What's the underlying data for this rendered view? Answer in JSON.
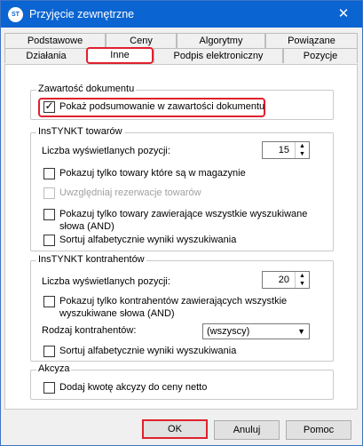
{
  "window": {
    "icon_text": "ST",
    "title": "Przyjęcie zewnętrzne",
    "close_glyph": "✕"
  },
  "tabs": {
    "row1": [
      "Podstawowe",
      "Ceny",
      "Algorytmy",
      "Powiązane"
    ],
    "row2": [
      "Działania",
      "Inne",
      "Podpis elektroniczny",
      "Pozycje"
    ],
    "active": "Inne"
  },
  "zawartosc": {
    "title": "Zawartość dokumentu",
    "summary_checkbox": {
      "label": "Pokaż podsumowanie w zawartości dokumentu",
      "checked": true
    }
  },
  "towary": {
    "title": "InsTYNKT towarów",
    "count_label": "Liczba wyświetlanych pozycji:",
    "count_value": "15",
    "only_in_stock": {
      "label": "Pokazuj tylko towary które są w magazynie",
      "checked": false
    },
    "reservations": {
      "label": "Uwzględniaj rezerwacje towarów",
      "checked": false,
      "disabled": true
    },
    "all_words_line1": "Pokazuj tylko towary zawierające wszystkie wyszukiwane",
    "all_words_line2": "słowa (AND)",
    "sort_alpha": {
      "label": "Sortuj alfabetycznie wyniki wyszukiwania",
      "checked": false
    }
  },
  "kontrahenci": {
    "title": "InsTYNKT kontrahentów",
    "count_label": "Liczba wyświetlanych pozycji:",
    "count_value": "20",
    "all_words_line1": "Pokazuj tylko kontrahentów zawierających wszystkie",
    "all_words_line2": "wyszukiwane słowa (AND)",
    "type_label": "Rodzaj kontrahentów:",
    "type_value": "(wszyscy)",
    "sort_alpha": {
      "label": "Sortuj alfabetycznie wyniki wyszukiwania",
      "checked": false
    }
  },
  "akcyza": {
    "title": "Akcyza",
    "add_excise": {
      "label": "Dodaj kwotę akcyzy do ceny netto",
      "checked": false
    }
  },
  "buttons": {
    "ok": "OK",
    "cancel": "Anuluj",
    "help": "Pomoc"
  },
  "colors": {
    "titlebar": "#0a64d2",
    "highlight": "#e0202d"
  }
}
